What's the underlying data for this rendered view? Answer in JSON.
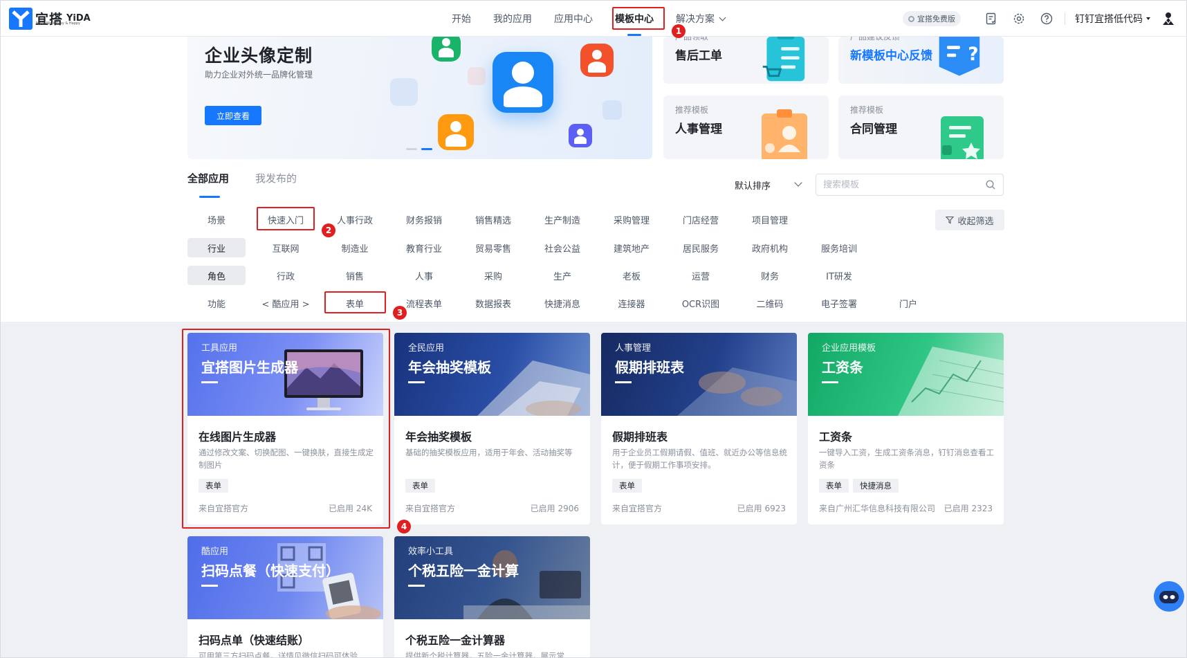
{
  "header": {
    "logo_cn": "宜搭",
    "logo_en": "YiDA",
    "logo_tagline": "Make Work Easy & Happy",
    "nav": [
      {
        "label": "开始"
      },
      {
        "label": "我的应用"
      },
      {
        "label": "应用中心"
      },
      {
        "label": "模板中心",
        "active": true
      },
      {
        "label": "解决方案",
        "dropdown": true
      }
    ],
    "free_badge": "宜搭免费版",
    "org_name": "钉钉宜搭低代码"
  },
  "banner": {
    "title": "企业头像定制",
    "subtitle": "助力企业对外统一品牌化管理",
    "button": "立即查看",
    "slide_count": 2,
    "active_slide": 2
  },
  "side_tiles": [
    {
      "label": "产品领取",
      "title": "售后工单"
    },
    {
      "label": "产品建议反馈",
      "title": "新模板中心反馈",
      "highlight": true
    },
    {
      "label": "推荐模板",
      "title": "人事管理"
    },
    {
      "label": "推荐模板",
      "title": "合同管理"
    }
  ],
  "tabs": [
    {
      "label": "全部应用",
      "active": true
    },
    {
      "label": "我发布的"
    }
  ],
  "sort": {
    "label": "默认排序"
  },
  "search": {
    "placeholder": "搜索模板",
    "value": ""
  },
  "collapse_button": "收起筛选",
  "filters": {
    "scene": {
      "label": "场景",
      "options": [
        "快速入门",
        "人事行政",
        "财务报销",
        "销售精选",
        "生产制造",
        "采购管理",
        "门店经营",
        "项目管理"
      ]
    },
    "industry": {
      "label": "行业",
      "options": [
        "互联网",
        "制造业",
        "教育行业",
        "贸易零售",
        "社会公益",
        "建筑地产",
        "居民服务",
        "政府机构",
        "服务培训"
      ]
    },
    "role": {
      "label": "角色",
      "options": [
        "行政",
        "销售",
        "人事",
        "采购",
        "生产",
        "老板",
        "运营",
        "财务",
        "IT研发"
      ]
    },
    "function": {
      "label": "功能",
      "options": [
        "< 酷应用 >",
        "表单",
        "流程表单",
        "数据报表",
        "快捷消息",
        "连接器",
        "OCR识图",
        "二维码",
        "电子签署",
        "门户"
      ]
    }
  },
  "cards": [
    {
      "category": "工具应用",
      "image_title": "宜搭图片生成器",
      "name": "在线图片生成器",
      "desc": "通过修改文案、切换配图、一键换肤，直接生成定制图片",
      "tags": [
        "表单"
      ],
      "source": "来自宜搭官方",
      "used": "已启用 24K",
      "theme": "#5b78ef"
    },
    {
      "category": "全民应用",
      "image_title": "年会抽奖模板",
      "name": "年会抽奖模板",
      "desc": "基础的抽奖模板应用，适用于年会、活动抽奖等",
      "tags": [
        "表单"
      ],
      "source": "来自宜搭官方",
      "used": "已启用 2906",
      "theme": "#1d3d8f"
    },
    {
      "category": "人事管理",
      "image_title": "假期排班表",
      "name": "假期排班表",
      "desc": "用于企业员工假期请假、值班、就近办公等信息统计，便于假期工作事项安排。",
      "tags": [
        "表单"
      ],
      "source": "来自宜搭官方",
      "used": "已启用 6923",
      "theme": "#1b2f6e"
    },
    {
      "category": "企业应用模板",
      "image_title": "工资条",
      "name": "工资条",
      "desc": "一键导入工资，生成工资条消息，钉钉消息查看工资条",
      "tags": [
        "表单",
        "快捷消息"
      ],
      "source": "来自广州汇华信息科技有限公司",
      "used": "已启用 2323",
      "theme": "#14b36a"
    },
    {
      "category": "酷应用",
      "image_title": "扫码点餐（快速支付）",
      "name": "扫码点单（快速结账）",
      "desc": "可用第三方扫码点餐，详情见微信扫码可体验",
      "tags": [],
      "source": "",
      "used": "",
      "theme": "#5572ec"
    },
    {
      "category": "效率小工具",
      "image_title": "个税五险一金计算",
      "name": "个税五险一金计算器",
      "desc": "提供新个税计算器，五险一金计算器，展示常",
      "tags": [],
      "source": "",
      "used": "",
      "theme": "#2b4a86"
    }
  ],
  "annotations": [
    "1",
    "2",
    "3",
    "4"
  ],
  "colors": {
    "accent": "#1677ff",
    "annotation": "#e02020"
  }
}
